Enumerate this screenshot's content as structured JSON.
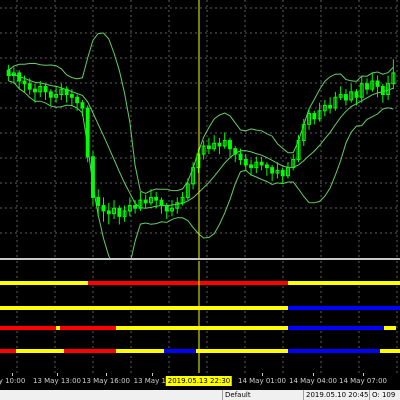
{
  "colors": {
    "background": "#000000",
    "grid": "#606060",
    "candle_body": "#00ff00",
    "candle_wick": "#00ff00",
    "bands": "#66cc66",
    "crosshair": "#ffff00",
    "separator": "#c8c8c8",
    "state_yellow": "#ffff00",
    "state_red": "#ff0000",
    "state_blue": "#0000ff"
  },
  "time_axis": {
    "labels": [
      "y 10:00",
      "13 May 13:00",
      "13 May 16:00",
      "13 May 19",
      "14 May 01:00",
      "14 May 04:00",
      "14 May 07:00"
    ],
    "crosshair_label": "2019.05.13 22:30"
  },
  "status_bar": {
    "profile": "Default",
    "datetime": "2019.05.10 20:45",
    "open": "O: 109"
  },
  "indicator_rows": [
    {
      "name": "row-1",
      "segments": [
        [
          "yellow",
          0,
          22
        ],
        [
          "red",
          22,
          72
        ],
        [
          "yellow",
          72,
          100
        ]
      ]
    },
    {
      "name": "row-2",
      "segments": [
        [
          "yellow",
          0,
          72
        ],
        [
          "blue",
          72,
          100
        ]
      ]
    },
    {
      "name": "row-3",
      "segments": [
        [
          "red",
          0,
          14
        ],
        [
          "yellow",
          14,
          15
        ],
        [
          "red",
          15,
          29
        ],
        [
          "yellow",
          29,
          72
        ],
        [
          "blue",
          72,
          96
        ],
        [
          "yellow",
          96,
          99
        ]
      ]
    },
    {
      "name": "row-4",
      "segments": [
        [
          "red",
          0,
          4
        ],
        [
          "yellow",
          4,
          16
        ],
        [
          "red",
          16,
          29
        ],
        [
          "yellow",
          29,
          41
        ],
        [
          "blue",
          41,
          49
        ],
        [
          "yellow",
          49,
          72
        ],
        [
          "blue",
          72,
          95
        ],
        [
          "yellow",
          95,
          100
        ]
      ]
    }
  ],
  "chart_data": {
    "type": "candlestick",
    "title": "",
    "xlabel": "",
    "ylabel": "",
    "series": [
      {
        "ohlc": [
          [
            62,
            60,
            64,
            58
          ],
          [
            60,
            61,
            63,
            57
          ],
          [
            61,
            58,
            62,
            55
          ],
          [
            58,
            57,
            60,
            54
          ],
          [
            57,
            55,
            59,
            53
          ],
          [
            55,
            54,
            57,
            50
          ],
          [
            54,
            56,
            58,
            52
          ],
          [
            56,
            54,
            57,
            51
          ],
          [
            54,
            52,
            55,
            49
          ],
          [
            52,
            53,
            56,
            50
          ],
          [
            53,
            55,
            57,
            51
          ],
          [
            55,
            53,
            56,
            50
          ],
          [
            53,
            52,
            55,
            49
          ],
          [
            52,
            50,
            53,
            47
          ],
          [
            50,
            48,
            51,
            45
          ],
          [
            48,
            30,
            49,
            28
          ],
          [
            30,
            15,
            32,
            12
          ],
          [
            15,
            12,
            18,
            8
          ],
          [
            12,
            10,
            15,
            6
          ],
          [
            10,
            9,
            13,
            5
          ],
          [
            9,
            11,
            14,
            7
          ],
          [
            11,
            8,
            12,
            5
          ],
          [
            8,
            10,
            12,
            6
          ],
          [
            10,
            12,
            15,
            8
          ],
          [
            12,
            11,
            14,
            9
          ],
          [
            11,
            14,
            17,
            10
          ],
          [
            14,
            13,
            16,
            11
          ],
          [
            13,
            15,
            18,
            12
          ],
          [
            15,
            14,
            17,
            11
          ],
          [
            14,
            12,
            15,
            9
          ],
          [
            12,
            10,
            13,
            7
          ],
          [
            10,
            11,
            14,
            8
          ],
          [
            11,
            13,
            15,
            9
          ],
          [
            13,
            15,
            17,
            12
          ],
          [
            15,
            20,
            22,
            14
          ],
          [
            20,
            26,
            28,
            18
          ],
          [
            26,
            31,
            33,
            24
          ],
          [
            31,
            34,
            36,
            29
          ],
          [
            34,
            33,
            37,
            31
          ],
          [
            33,
            35,
            38,
            32
          ],
          [
            35,
            34,
            37,
            31
          ],
          [
            34,
            36,
            39,
            33
          ],
          [
            36,
            33,
            37,
            30
          ],
          [
            33,
            31,
            34,
            28
          ],
          [
            31,
            29,
            33,
            27
          ],
          [
            29,
            27,
            31,
            25
          ],
          [
            27,
            26,
            29,
            23
          ],
          [
            26,
            28,
            30,
            24
          ],
          [
            28,
            27,
            30,
            25
          ],
          [
            27,
            26,
            28,
            23
          ],
          [
            26,
            24,
            27,
            21
          ],
          [
            24,
            25,
            28,
            22
          ],
          [
            25,
            23,
            26,
            20
          ],
          [
            23,
            26,
            28,
            22
          ],
          [
            26,
            29,
            31,
            25
          ],
          [
            29,
            36,
            38,
            28
          ],
          [
            36,
            42,
            44,
            34
          ],
          [
            42,
            46,
            48,
            40
          ],
          [
            46,
            44,
            47,
            42
          ],
          [
            44,
            47,
            50,
            43
          ],
          [
            47,
            49,
            51,
            45
          ],
          [
            49,
            48,
            52,
            46
          ],
          [
            48,
            52,
            54,
            47
          ],
          [
            52,
            53,
            56,
            51
          ],
          [
            53,
            51,
            55,
            49
          ],
          [
            51,
            54,
            57,
            50
          ],
          [
            54,
            52,
            55,
            49
          ],
          [
            52,
            57,
            60,
            50
          ],
          [
            57,
            55,
            59,
            53
          ],
          [
            55,
            58,
            61,
            54
          ],
          [
            58,
            56,
            60,
            52
          ],
          [
            56,
            53,
            57,
            50
          ],
          [
            53,
            57,
            60,
            51
          ],
          [
            57,
            61,
            66,
            55
          ]
        ]
      }
    ]
  }
}
